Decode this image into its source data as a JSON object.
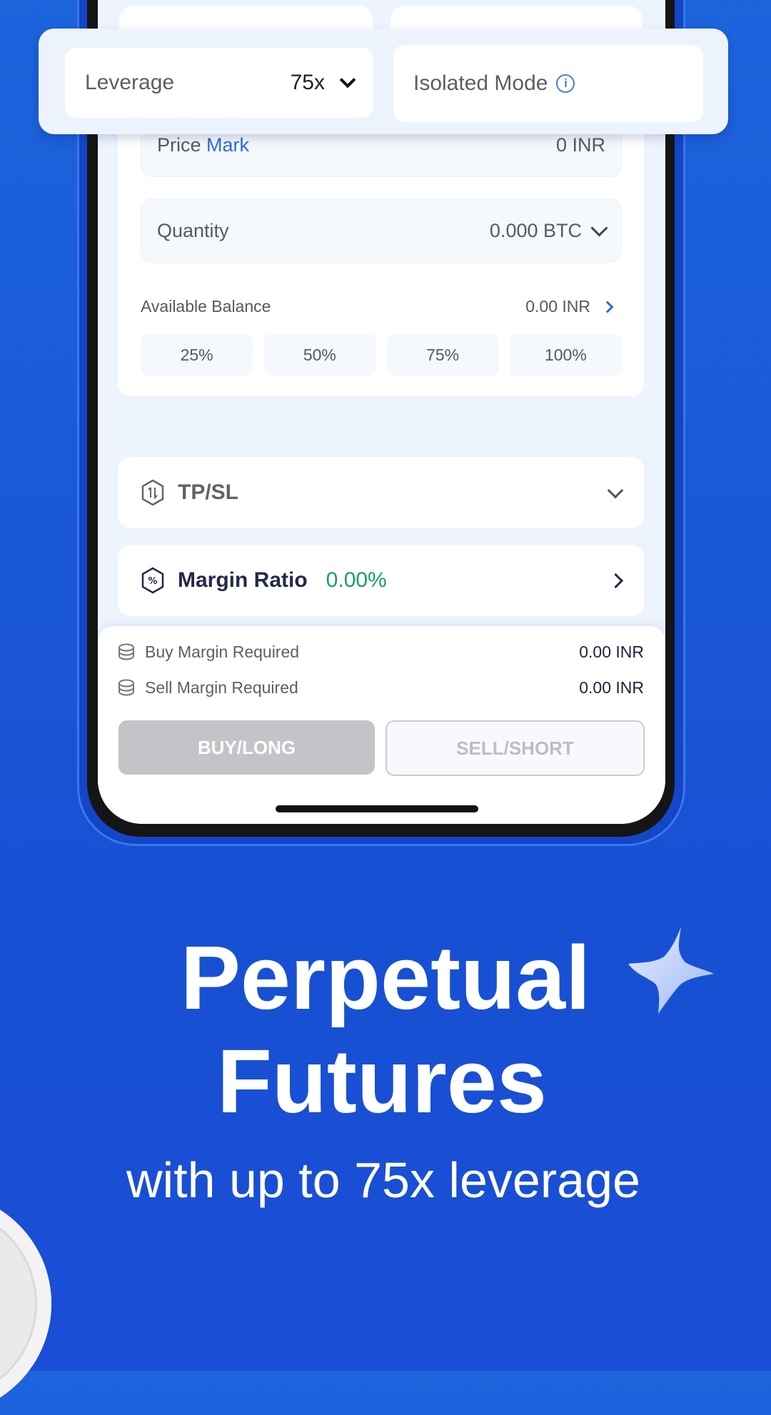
{
  "overlay": {
    "leverage_label": "Leverage",
    "leverage_value": "75x",
    "mode_label": "Isolated Mode"
  },
  "form": {
    "price_label": "Price",
    "price_type": "Mark",
    "price_value": "0 INR",
    "quantity_label": "Quantity",
    "quantity_value": "0.000 BTC",
    "balance_label": "Available Balance",
    "balance_value": "0.00 INR",
    "percent_options": [
      "25%",
      "50%",
      "75%",
      "100%"
    ]
  },
  "tpsl": {
    "label": "TP/SL"
  },
  "margin_ratio": {
    "label": "Margin Ratio",
    "value": "0.00%"
  },
  "summary": {
    "buy_margin_label": "Buy Margin Required",
    "buy_margin_value": "0.00 INR",
    "sell_margin_label": "Sell Margin Required",
    "sell_margin_value": "0.00 INR"
  },
  "actions": {
    "buy_label": "BUY/LONG",
    "sell_label": "SELL/SHORT"
  },
  "hero": {
    "title_line1": "Perpetual",
    "title_line2": "Futures",
    "subtitle": "with up to 75x leverage"
  },
  "colors": {
    "background": "#1a58d6",
    "accent_blue": "#2e6bdf",
    "positive_green": "#16a06b",
    "disabled_gray": "#c3c4c8"
  }
}
